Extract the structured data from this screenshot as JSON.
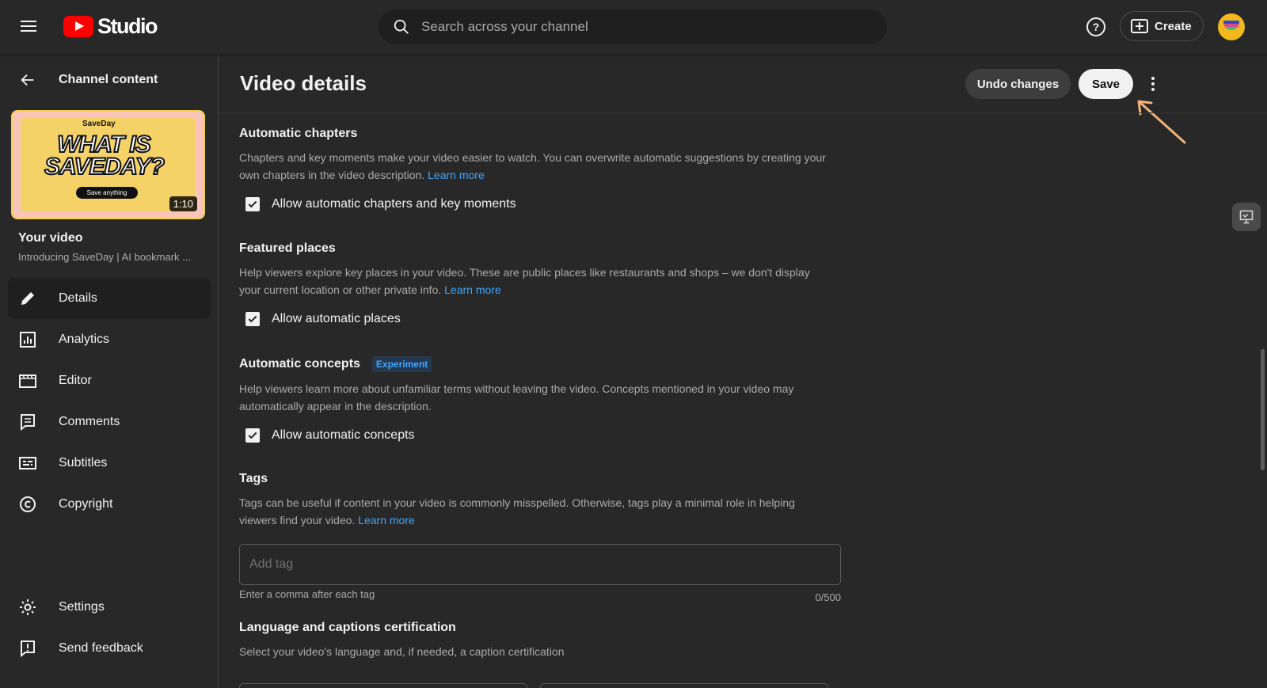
{
  "topbar": {
    "logo_text": "Studio",
    "search_placeholder": "Search across your channel",
    "help_symbol": "?",
    "create_label": "Create"
  },
  "sidebar": {
    "back_label": "Channel content",
    "thumbnail": {
      "brand": "SaveDay",
      "title": "WHAT IS SAVEDAY?",
      "pill": "Save anything",
      "duration": "1:10"
    },
    "your_video_label": "Your video",
    "video_title": "Introducing SaveDay | AI bookmark ...",
    "nav_items": [
      {
        "label": "Details",
        "icon": "pencil-icon",
        "active": true
      },
      {
        "label": "Analytics",
        "icon": "analytics-icon"
      },
      {
        "label": "Editor",
        "icon": "editor-icon"
      },
      {
        "label": "Comments",
        "icon": "comments-icon"
      },
      {
        "label": "Subtitles",
        "icon": "subtitles-icon"
      },
      {
        "label": "Copyright",
        "icon": "copyright-icon"
      }
    ],
    "bottom_items": [
      {
        "label": "Settings",
        "icon": "gear-icon"
      },
      {
        "label": "Send feedback",
        "icon": "feedback-icon"
      }
    ]
  },
  "main": {
    "page_title": "Video details",
    "undo_label": "Undo changes",
    "save_label": "Save",
    "sections": {
      "chapters": {
        "title": "Automatic chapters",
        "desc": "Chapters and key moments make your video easier to watch. You can overwrite automatic suggestions by creating your own chapters in the video description.",
        "link": "Learn more",
        "checkbox_label": "Allow automatic chapters and key moments",
        "checked": true
      },
      "places": {
        "title": "Featured places",
        "desc": "Help viewers explore key places in your video. These are public places like restaurants and shops – we don't display your current location or other private info.",
        "link": "Learn more",
        "checkbox_label": "Allow automatic places",
        "checked": true
      },
      "concepts": {
        "title": "Automatic concepts",
        "badge": "Experiment",
        "desc": "Help viewers learn more about unfamiliar terms without leaving the video. Concepts mentioned in your video may automatically appear in the description.",
        "checkbox_label": "Allow automatic concepts",
        "checked": true
      },
      "tags": {
        "title": "Tags",
        "desc": "Tags can be useful if content in your video is commonly misspelled. Otherwise, tags play a minimal role in helping viewers find your video.",
        "link": "Learn more",
        "input_placeholder": "Add tag",
        "hint": "Enter a comma after each tag",
        "count": "0/500"
      },
      "language": {
        "title": "Language and captions certification",
        "desc": "Select your video's language and, if needed, a caption certification"
      }
    }
  },
  "colors": {
    "background": "#282828",
    "link": "#3ea6ff",
    "brand_red": "#ff0000",
    "annotation_arrow": "#f0b27a"
  }
}
